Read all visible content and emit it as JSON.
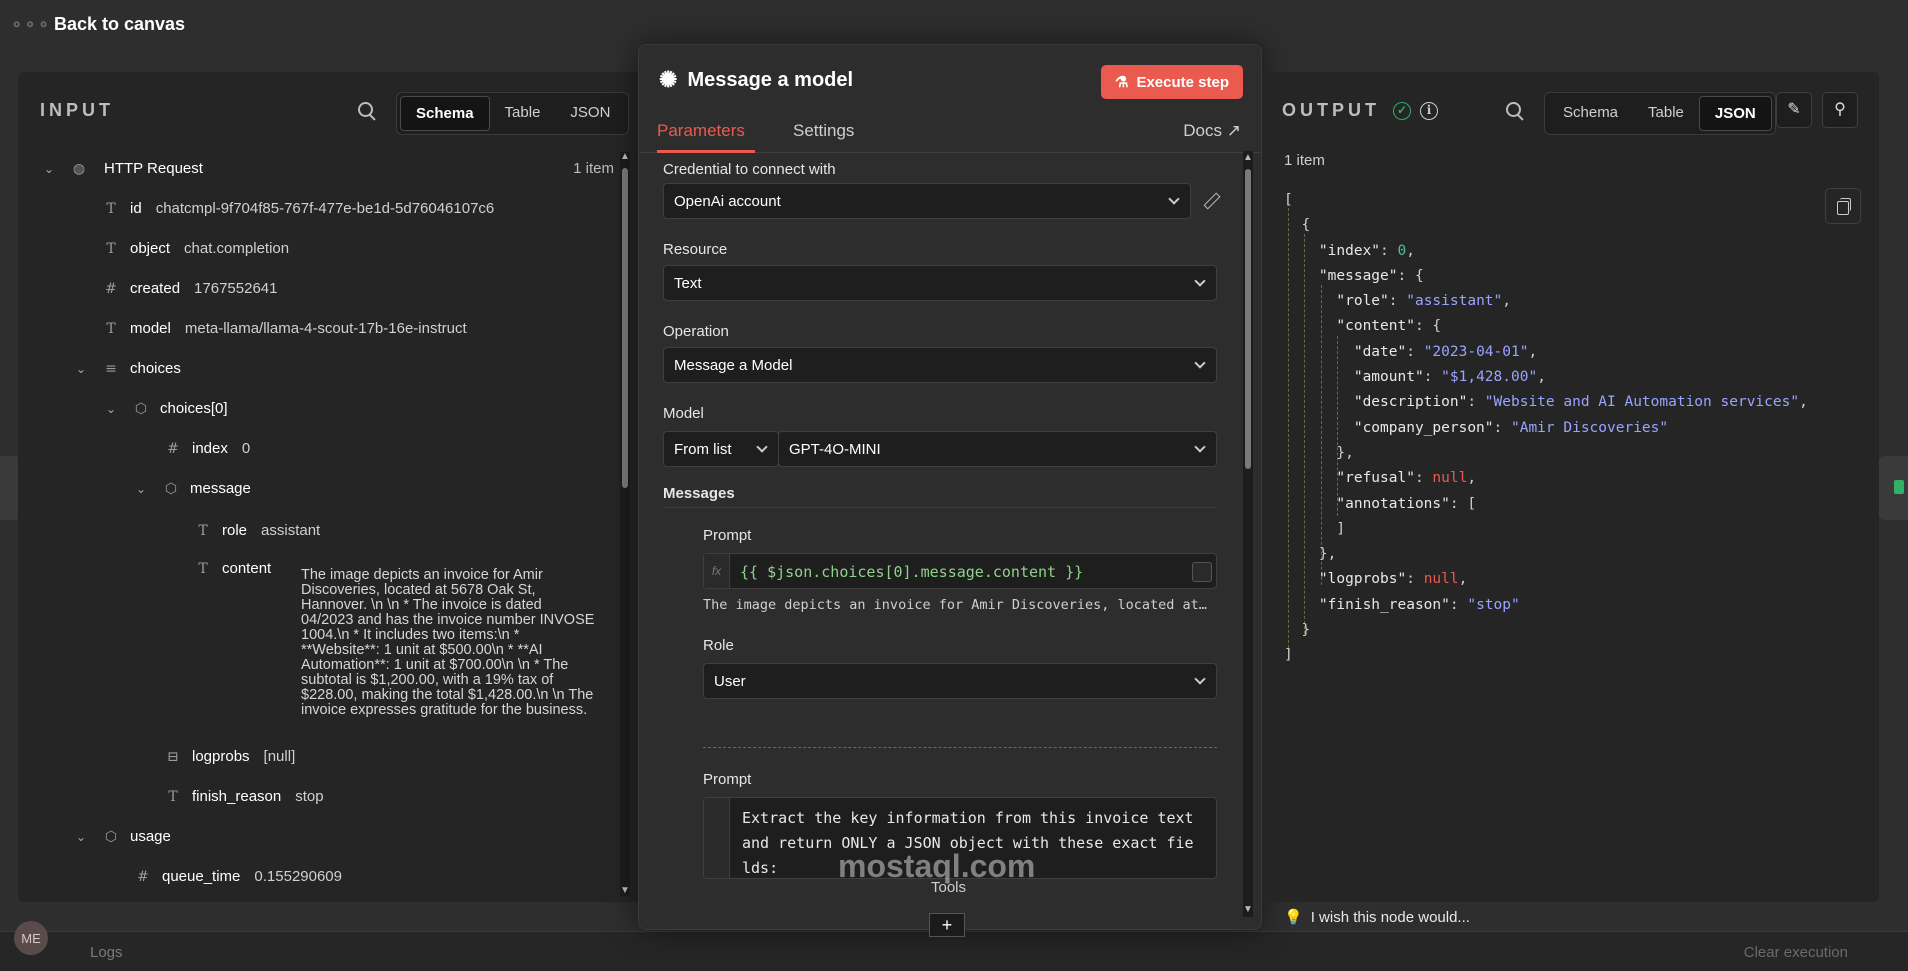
{
  "nav": {
    "back_label": "Back to canvas"
  },
  "footer": {
    "logs_label": "Logs",
    "clear_label": "Clear execution",
    "avatar_initials": "ME"
  },
  "input": {
    "title": "INPUT",
    "views": [
      "Schema",
      "Table",
      "JSON"
    ],
    "active_view": "Schema",
    "root": {
      "label": "HTTP Request",
      "count": "1 item"
    },
    "fields": {
      "id": {
        "key": "id",
        "value": "chatcmpl-9f704f85-767f-477e-be1d-5d76046107c6"
      },
      "object": {
        "key": "object",
        "value": "chat.completion"
      },
      "created": {
        "key": "created",
        "value": "1767552641"
      },
      "model": {
        "key": "model",
        "value": "meta-llama/llama-4-scout-17b-16e-instruct"
      },
      "choices": {
        "key": "choices"
      },
      "choices0": {
        "key": "choices[0]"
      },
      "index": {
        "key": "index",
        "value": "0"
      },
      "message": {
        "key": "message"
      },
      "role": {
        "key": "role",
        "value": "assistant"
      },
      "content": {
        "key": "content",
        "value": "The image depicts an invoice for Amir Discoveries, located at 5678 Oak St, Hannover. \\n \\n * The invoice is dated 04/2023 and has the invoice number INVOSE 1004.\\n * It includes two items:\\n * **Website**: 1 unit at $500.00\\n * **AI Automation**: 1 unit at $700.00\\n \\n * The subtotal is $1,200.00, with a 19% tax of $228.00, making the total $1,428.00.\\n \\n The invoice expresses gratitude for the business."
      },
      "logprobs": {
        "key": "logprobs",
        "value": "[null]"
      },
      "finish_reason": {
        "key": "finish_reason",
        "value": "stop"
      },
      "usage": {
        "key": "usage"
      },
      "queue_time": {
        "key": "queue_time",
        "value": "0.155290609"
      }
    }
  },
  "node": {
    "title": "Message a model",
    "execute_label": "Execute step",
    "tabs": {
      "parameters": "Parameters",
      "settings": "Settings",
      "docs": "Docs"
    },
    "credential": {
      "label": "Credential to connect with",
      "value": "OpenAi account"
    },
    "resource": {
      "label": "Resource",
      "value": "Text"
    },
    "operation": {
      "label": "Operation",
      "value": "Message a Model"
    },
    "model": {
      "label": "Model",
      "mode": "From list",
      "value": "GPT-4O-MINI"
    },
    "messages_label": "Messages",
    "prompt1": {
      "label": "Prompt",
      "expression": "{{ $json.choices[0].message.content }}",
      "preview": "The image depicts an invoice for Amir Discoveries, located at…"
    },
    "role": {
      "label": "Role",
      "value": "User"
    },
    "prompt2": {
      "label": "Prompt",
      "text": "Extract the key information from this invoice text and return ONLY a JSON object with these exact fields:"
    },
    "tools_label": "Tools",
    "plus_label": "+"
  },
  "output": {
    "title": "OUTPUT",
    "views": [
      "Schema",
      "Table",
      "JSON"
    ],
    "active_view": "JSON",
    "count": "1 item",
    "json_lines": [
      [
        [
          "jp",
          "["
        ]
      ],
      [
        [
          "jp",
          "  {"
        ]
      ],
      [
        [
          "jk",
          "    \"index\""
        ],
        [
          "jp",
          ": "
        ],
        [
          "jn",
          "0"
        ],
        [
          "jp",
          ","
        ]
      ],
      [
        [
          "jk",
          "    \"message\""
        ],
        [
          "jp",
          ": {"
        ]
      ],
      [
        [
          "jk",
          "      \"role\""
        ],
        [
          "jp",
          ": "
        ],
        [
          "js",
          "\"assistant\""
        ],
        [
          "jp",
          ","
        ]
      ],
      [
        [
          "jk",
          "      \"content\""
        ],
        [
          "jp",
          ": {"
        ]
      ],
      [
        [
          "jk",
          "        \"date\""
        ],
        [
          "jp",
          ": "
        ],
        [
          "js",
          "\"2023-04-01\""
        ],
        [
          "jp",
          ","
        ]
      ],
      [
        [
          "jk",
          "        \"amount\""
        ],
        [
          "jp",
          ": "
        ],
        [
          "js",
          "\"$1,428.00\""
        ],
        [
          "jp",
          ","
        ]
      ],
      [
        [
          "jk",
          "        \"description\""
        ],
        [
          "jp",
          ": "
        ],
        [
          "js",
          "\"Website and AI Automation services\""
        ],
        [
          "jp",
          ","
        ]
      ],
      [
        [
          "jk",
          "        \"company_person\""
        ],
        [
          "jp",
          ": "
        ],
        [
          "js",
          "\"Amir Discoveries\""
        ]
      ],
      [
        [
          "jp",
          "      },"
        ]
      ],
      [
        [
          "jk",
          "      \"refusal\""
        ],
        [
          "jp",
          ": "
        ],
        [
          "jnull",
          "null"
        ],
        [
          "jp",
          ","
        ]
      ],
      [
        [
          "jk",
          "      \"annotations\""
        ],
        [
          "jp",
          ": ["
        ]
      ],
      [
        [
          "jp",
          "      ]"
        ]
      ],
      [
        [
          "jp",
          "    },"
        ]
      ],
      [
        [
          "jk",
          "    \"logprobs\""
        ],
        [
          "jp",
          ": "
        ],
        [
          "jnull",
          "null"
        ],
        [
          "jp",
          ","
        ]
      ],
      [
        [
          "jk",
          "    \"finish_reason\""
        ],
        [
          "jp",
          ": "
        ],
        [
          "js",
          "\"stop\""
        ]
      ],
      [
        [
          "jp",
          "  }"
        ]
      ],
      [
        [
          "jp",
          "]"
        ]
      ]
    ],
    "wish_label": "I wish this node would..."
  },
  "watermark": "mostaql.com",
  "colors": {
    "accent": "#ea5a4e",
    "success": "#2fb167",
    "json_number": "#4fc08d",
    "json_string": "#9aa4ff"
  }
}
